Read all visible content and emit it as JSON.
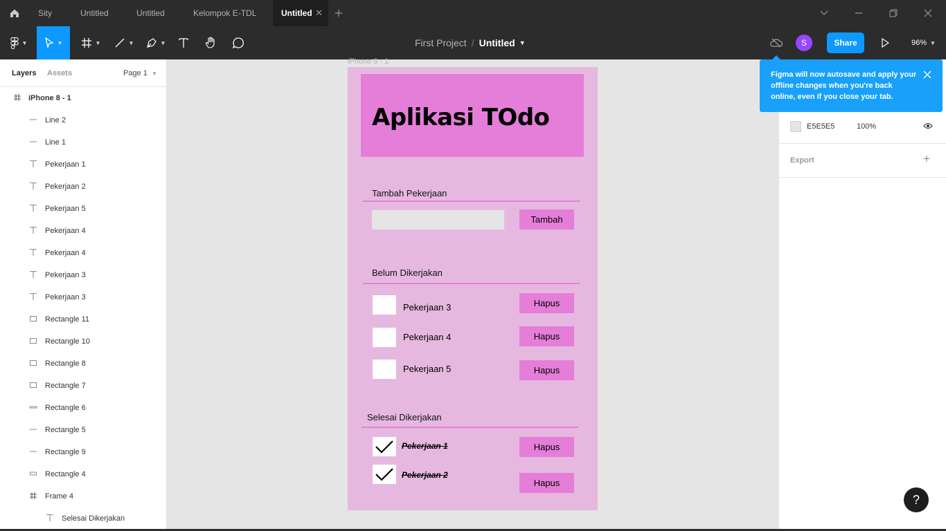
{
  "tabs": [
    {
      "label": "Sity"
    },
    {
      "label": "Untitled"
    },
    {
      "label": "Untitled"
    },
    {
      "label": "Kelompok E-TDL"
    },
    {
      "label": "Untitled",
      "active": true
    }
  ],
  "toolbar": {
    "project": "First Project",
    "separator": "/",
    "file": "Untitled",
    "avatar_initial": "S",
    "share_label": "Share",
    "zoom": "96%"
  },
  "left_panel": {
    "tab_layers": "Layers",
    "tab_assets": "Assets",
    "page": "Page 1",
    "layers": [
      {
        "name": "iPhone 8 - 1",
        "icon": "frame-icon",
        "indent": 0
      },
      {
        "name": "Line 2",
        "icon": "line-icon",
        "indent": 1
      },
      {
        "name": "Line 1",
        "icon": "line-icon",
        "indent": 1
      },
      {
        "name": "Pekerjaan 1",
        "icon": "text-icon",
        "indent": 1
      },
      {
        "name": "Pekerjaan 2",
        "icon": "text-icon",
        "indent": 1
      },
      {
        "name": "Pekerjaan 5",
        "icon": "text-icon",
        "indent": 1
      },
      {
        "name": "Pekerjaan 4",
        "icon": "text-icon",
        "indent": 1
      },
      {
        "name": "Pekerjaan 4",
        "icon": "text-icon",
        "indent": 1
      },
      {
        "name": "Pekerjaan 3",
        "icon": "text-icon",
        "indent": 1
      },
      {
        "name": "Pekerjaan 3",
        "icon": "text-icon",
        "indent": 1
      },
      {
        "name": "Rectangle 11",
        "icon": "rectangle-icon",
        "indent": 1
      },
      {
        "name": "Rectangle 10",
        "icon": "rectangle-icon",
        "indent": 1
      },
      {
        "name": "Rectangle 8",
        "icon": "rectangle-icon",
        "indent": 1
      },
      {
        "name": "Rectangle 7",
        "icon": "rectangle-icon",
        "indent": 1
      },
      {
        "name": "Rectangle 6",
        "icon": "thin-rectangle-icon",
        "indent": 1
      },
      {
        "name": "Rectangle 5",
        "icon": "line-icon",
        "indent": 1
      },
      {
        "name": "Rectangle 9",
        "icon": "line-icon",
        "indent": 1
      },
      {
        "name": "Rectangle 4",
        "icon": "flat-rectangle-icon",
        "indent": 1
      },
      {
        "name": "Frame 4",
        "icon": "frame-icon",
        "indent": 1
      },
      {
        "name": "Selesai Dikerjakan",
        "icon": "text-icon",
        "indent": 2
      }
    ]
  },
  "canvas": {
    "frame_label": "iPhone 8 - 1",
    "app_title": "Aplikasi TOdo",
    "add_section": "Tambah Pekerjaan",
    "add_button": "Tambah",
    "todo_section": "Belum Dikerjakan",
    "todo_items": [
      "Pekerjaan 3",
      "Pekerjaan 4",
      "Pekerjaan 5"
    ],
    "done_section": "Selesai Dikerjakan",
    "done_items": [
      "Pekerjaan 1",
      "Pekerjaan 2"
    ],
    "delete_label": "Hapus"
  },
  "right_panel": {
    "fill_hex": "E5E5E5",
    "fill_opacity": "100%",
    "export_label": "Export"
  },
  "toast": {
    "message": "Figma will now autosave and apply your offline changes when you're back online, even if you close your tab."
  },
  "help_label": "?",
  "colors": {
    "accent": "#0d99ff",
    "frame_bg": "#e6b8e0",
    "pink": "#e57ed9",
    "toast": "#18a0fb"
  }
}
